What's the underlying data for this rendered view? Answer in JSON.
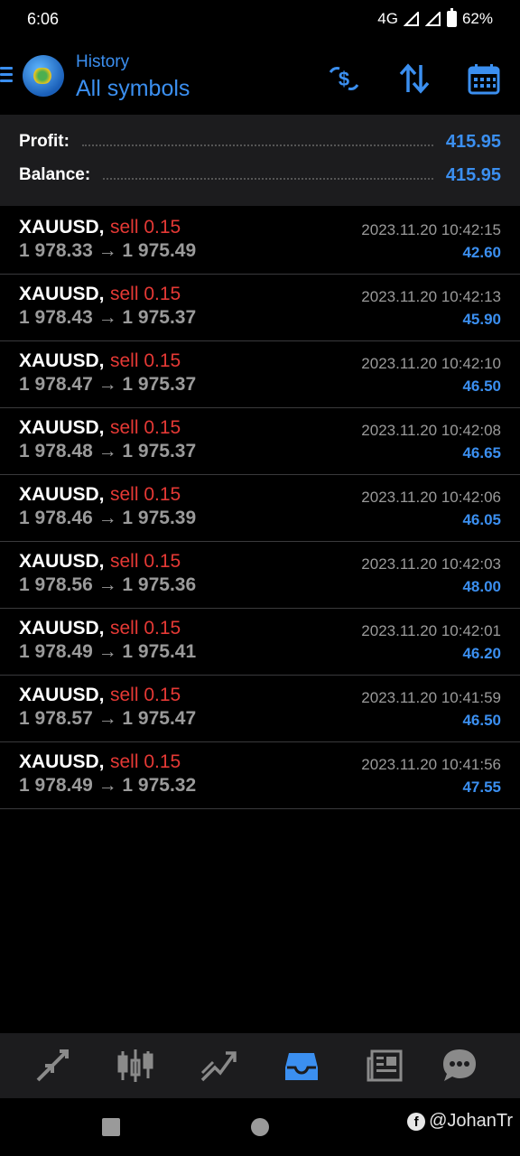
{
  "status_bar": {
    "time": "6:06",
    "network": "4G",
    "battery": "62%"
  },
  "header": {
    "subtitle": "History",
    "title": "All symbols"
  },
  "summary": {
    "profit_label": "Profit:",
    "profit_value": "415.95",
    "balance_label": "Balance:",
    "balance_value": "415.95"
  },
  "trades": [
    {
      "symbol": "XAUUSD,",
      "side": "sell 0.15",
      "prices": "1 978.33 → 1 975.49",
      "time": "2023.11.20 10:42:15",
      "profit": "42.60"
    },
    {
      "symbol": "XAUUSD,",
      "side": "sell 0.15",
      "prices": "1 978.43 → 1 975.37",
      "time": "2023.11.20 10:42:13",
      "profit": "45.90"
    },
    {
      "symbol": "XAUUSD,",
      "side": "sell 0.15",
      "prices": "1 978.47 → 1 975.37",
      "time": "2023.11.20 10:42:10",
      "profit": "46.50"
    },
    {
      "symbol": "XAUUSD,",
      "side": "sell 0.15",
      "prices": "1 978.48 → 1 975.37",
      "time": "2023.11.20 10:42:08",
      "profit": "46.65"
    },
    {
      "symbol": "XAUUSD,",
      "side": "sell 0.15",
      "prices": "1 978.46 → 1 975.39",
      "time": "2023.11.20 10:42:06",
      "profit": "46.05"
    },
    {
      "symbol": "XAUUSD,",
      "side": "sell 0.15",
      "prices": "1 978.56 → 1 975.36",
      "time": "2023.11.20 10:42:03",
      "profit": "48.00"
    },
    {
      "symbol": "XAUUSD,",
      "side": "sell 0.15",
      "prices": "1 978.49 → 1 975.41",
      "time": "2023.11.20 10:42:01",
      "profit": "46.20"
    },
    {
      "symbol": "XAUUSD,",
      "side": "sell 0.15",
      "prices": "1 978.57 → 1 975.47",
      "time": "2023.11.20 10:41:59",
      "profit": "46.50"
    },
    {
      "symbol": "XAUUSD,",
      "side": "sell 0.15",
      "prices": "1 978.49 → 1 975.32",
      "time": "2023.11.20 10:41:56",
      "profit": "47.55"
    }
  ],
  "tabs": [
    {
      "icon": "quotes-icon"
    },
    {
      "icon": "chart-icon"
    },
    {
      "icon": "trade-icon"
    },
    {
      "icon": "history-icon",
      "active": true
    },
    {
      "icon": "news-icon"
    },
    {
      "icon": "chat-icon"
    }
  ],
  "watermark": "@JohanTr",
  "colors": {
    "accent": "#3b8ff0",
    "sell": "#e53935",
    "muted": "#9a9a9a",
    "panel": "#1c1c1e"
  }
}
